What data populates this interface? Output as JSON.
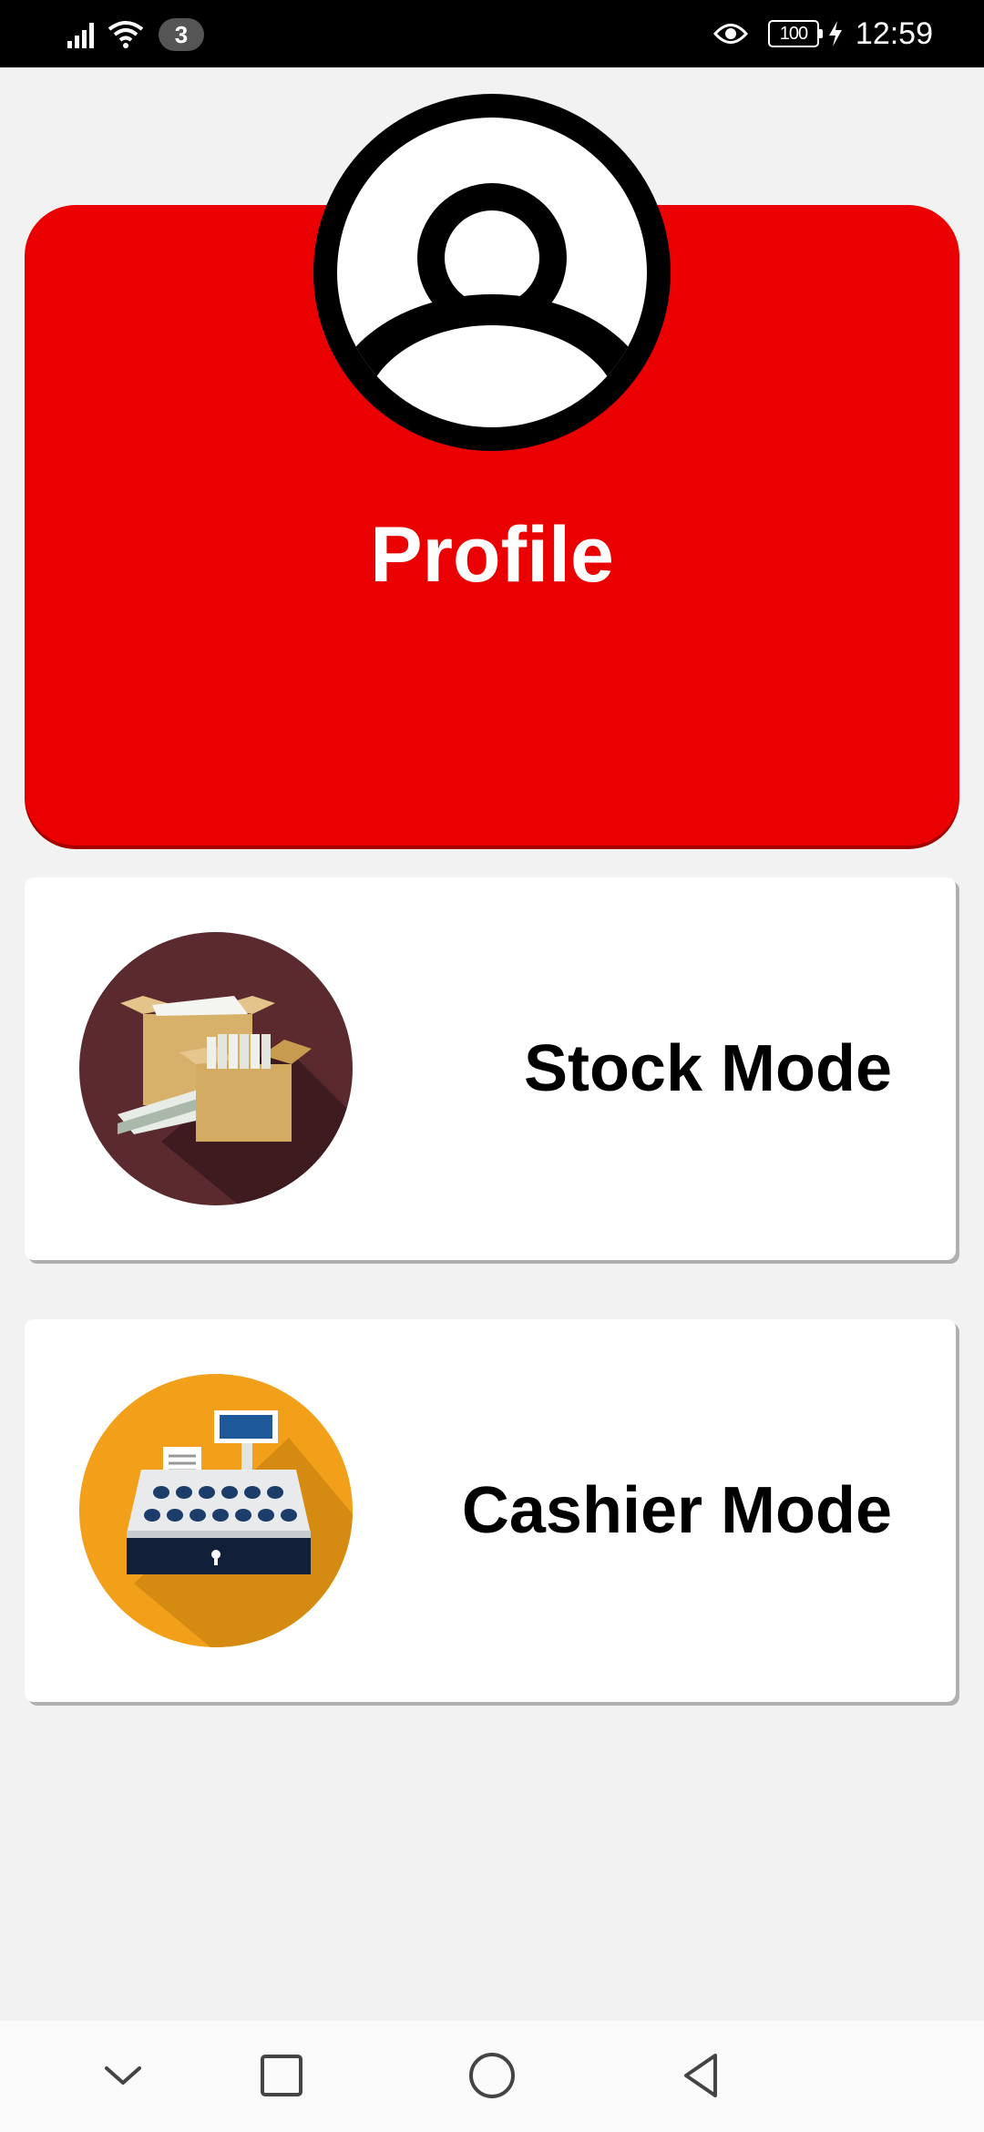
{
  "status_bar": {
    "notification_count": "3",
    "battery": "100",
    "time": "12:59",
    "icons": [
      "signal-icon",
      "wifi-icon",
      "eye-icon",
      "battery-icon",
      "charging-icon"
    ]
  },
  "profile": {
    "title": "Profile",
    "color": "#ea0000"
  },
  "modes": [
    {
      "label": "Stock Mode",
      "icon": "boxes-icon",
      "icon_bg": "#5a2a2e"
    },
    {
      "label": "Cashier Mode",
      "icon": "cash-register-icon",
      "icon_bg": "#f2a01a"
    }
  ],
  "nav_bar": {
    "buttons": [
      "chevron-down-icon",
      "recents-icon",
      "home-icon",
      "back-icon"
    ]
  }
}
